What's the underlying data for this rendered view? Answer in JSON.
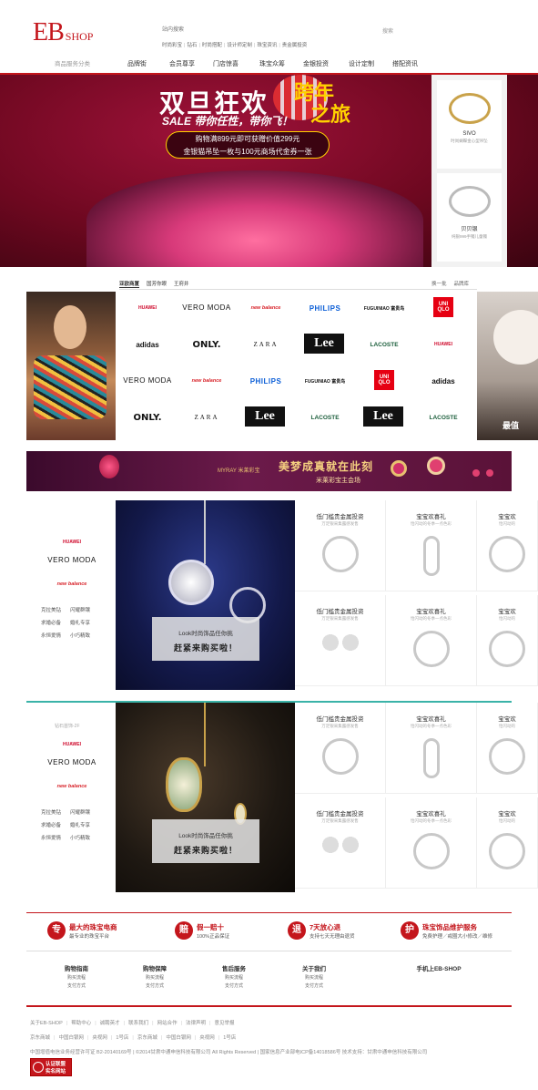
{
  "header": {
    "logo_main": "EB",
    "logo_sub": "SHOP",
    "search_placeholder": "站内搜索",
    "search_button": "搜索",
    "hotwords": [
      "时尚彩宝",
      "钻石",
      "时尚搭配",
      "设计师定制",
      "珠宝资讯",
      "贵金属投资"
    ]
  },
  "nav": {
    "category_label": "商品服务分类",
    "items": [
      "品牌街",
      "会员尊享",
      "门店惊喜",
      "珠宝众筹",
      "金银投资",
      "设计定制",
      "搭配资讯"
    ]
  },
  "banner": {
    "title": "双旦狂欢",
    "title_accent_1": "跨年",
    "title_accent_2": "之旅",
    "tagline": "SALE 带你任性，带你飞！",
    "promo_line_1": "购物满899元即可获赠价值299元",
    "promo_line_2": "金银猫吊坠一枚与100元商场代金券一张"
  },
  "side_panel": [
    {
      "name": "SIVO",
      "desc": "时尚蝴蝶金心型吊坠"
    },
    {
      "name": "贝贝银",
      "desc": "纯银999手镯儿童镯"
    }
  ],
  "brands": {
    "tabs": [
      "亚欧商厦",
      "国芳你眼",
      "王府井"
    ],
    "right_links": [
      "换一批",
      "品牌库"
    ],
    "logos": [
      {
        "text": "HUAWEI",
        "style": "huawei"
      },
      {
        "text": "VERO MODA",
        "style": "vero"
      },
      {
        "text": "new balance",
        "style": "nb"
      },
      {
        "text": "PHILIPS",
        "style": "philips"
      },
      {
        "text": "FUGUINIAO 富贵鸟",
        "style": "fug"
      },
      {
        "text": "UNI QLO",
        "style": "uniqlo"
      },
      {
        "text": "adidas",
        "style": "adidas"
      },
      {
        "text": "ONLY.",
        "style": "only"
      },
      {
        "text": "ZARA",
        "style": "zara"
      },
      {
        "text": "Lee",
        "style": "lee"
      },
      {
        "text": "LACOSTE",
        "style": "lacoste"
      },
      {
        "text": "HUAWEI",
        "style": "huawei"
      },
      {
        "text": "VERO MODA",
        "style": "vero"
      },
      {
        "text": "new balance",
        "style": "nb"
      },
      {
        "text": "PHILIPS",
        "style": "philips"
      },
      {
        "text": "FUGUINIAO 富贵鸟",
        "style": "fug"
      },
      {
        "text": "UNI QLO",
        "style": "uniqlo"
      },
      {
        "text": "adidas",
        "style": "adidas"
      },
      {
        "text": "ONLY.",
        "style": "only"
      },
      {
        "text": "ZARA",
        "style": "zara"
      },
      {
        "text": "Lee",
        "style": "lee"
      },
      {
        "text": "LACOSTE",
        "style": "lacoste"
      },
      {
        "text": "Lee",
        "style": "lee"
      },
      {
        "text": "LACOSTE",
        "style": "lacoste"
      }
    ],
    "right_peek_text": "最值"
  },
  "myray": {
    "brand": "MYRAY 米莱彩宝",
    "slogan": "美梦成真就在此刻",
    "sub": "米莱彩宝主会场"
  },
  "floors": [
    {
      "label": "",
      "logos": [
        "HUAWEI",
        "VERO MODA",
        "new balance"
      ],
      "tags": [
        [
          "克拉美钻",
          "闪耀群镶"
        ],
        [
          "求婚必备",
          "婚礼专享"
        ],
        [
          "永恒爱情",
          "小巧精致"
        ]
      ],
      "caption_1": "Look时尚饰品任你挑",
      "caption_2": "赶紧来购买啦！",
      "products": [
        {
          "title": "低门槛贵金属投资",
          "sub": "万足银采集露感发售",
          "shape": "ring"
        },
        {
          "title": "宝宝欢喜礼",
          "sub": "恰闪动的冬季一点色彩",
          "shape": "swirl"
        },
        {
          "title": "宝宝欢",
          "sub": "恰闪动的",
          "shape": "ring"
        },
        {
          "title": "低门槛贵金属投资",
          "sub": "万足银采集露感发售",
          "shape": "pair"
        },
        {
          "title": "宝宝欢喜礼",
          "sub": "恰闪动的冬季一点色彩",
          "shape": "ring"
        },
        {
          "title": "宝宝欢",
          "sub": "恰闪动的",
          "shape": "ring"
        }
      ]
    },
    {
      "label": "钻石首饰-2F",
      "logos": [
        "HUAWEI",
        "VERO MODA",
        "new balance"
      ],
      "tags": [
        [
          "克拉美钻",
          "闪耀群镶"
        ],
        [
          "求婚必备",
          "婚礼专享"
        ],
        [
          "永恒爱情",
          "小巧精致"
        ]
      ],
      "caption_1": "Look时尚饰品任你挑",
      "caption_2": "赶紧来购买啦！",
      "products": [
        {
          "title": "低门槛贵金属投资",
          "sub": "万足银采集露感发售",
          "shape": "ring"
        },
        {
          "title": "宝宝欢喜礼",
          "sub": "恰闪动的冬季一点色彩",
          "shape": "swirl"
        },
        {
          "title": "宝宝欢",
          "sub": "恰闪动的",
          "shape": "ring"
        },
        {
          "title": "低门槛贵金属投资",
          "sub": "万足银采集露感发售",
          "shape": "pair"
        },
        {
          "title": "宝宝欢喜礼",
          "sub": "恰闪动的冬季一点色彩",
          "shape": "ring"
        },
        {
          "title": "宝宝欢",
          "sub": "恰闪动的",
          "shape": "ring"
        }
      ]
    }
  ],
  "services": [
    {
      "icon": "专",
      "title": "最大的珠宝电商",
      "desc": "最专业的珠宝平台"
    },
    {
      "icon": "赔",
      "title": "假一赔十",
      "desc": "100%正品保证"
    },
    {
      "icon": "退",
      "title": "7天放心退",
      "desc": "支持七天无理由退货"
    },
    {
      "icon": "护",
      "title": "珠宝饰品维护服务",
      "desc": "免费护理／戒圈大小修改／维修"
    }
  ],
  "footer_cols": [
    {
      "title": "购物指南",
      "links": [
        "购买流程",
        "支付方式"
      ]
    },
    {
      "title": "购物保障",
      "links": [
        "购买流程",
        "支付方式"
      ]
    },
    {
      "title": "售后服务",
      "links": [
        "购买流程",
        "支付方式"
      ]
    },
    {
      "title": "关于我们",
      "links": [
        "购买流程",
        "支付方式"
      ]
    },
    {
      "title": "手机上EB-SHOP",
      "links": []
    }
  ],
  "footer_links_1": [
    "关于EB-SHOP",
    "帮助中心",
    "诚聘英才",
    "联系我们",
    "网站合作",
    "法律声明",
    "意见举报"
  ],
  "footer_links_2": [
    "京东商城",
    "中国白银网",
    "央视网",
    "1号店",
    "京东商城",
    "中国白银网",
    "央视网",
    "1号店"
  ],
  "copyright": "中国增值电信业务经营许可证 B2-20140169号 | ©2014甘肃中通申信科技有限公司 All Rights Reserved | 国家信息产业部电ICP备14018586号   技术支持：甘肃中通申信科技有限公司",
  "badge_line_1": "认证联盟",
  "badge_line_2": "实名网站",
  "colors": {
    "brand_red": "#c4161c",
    "teal": "#3bb3a8"
  }
}
